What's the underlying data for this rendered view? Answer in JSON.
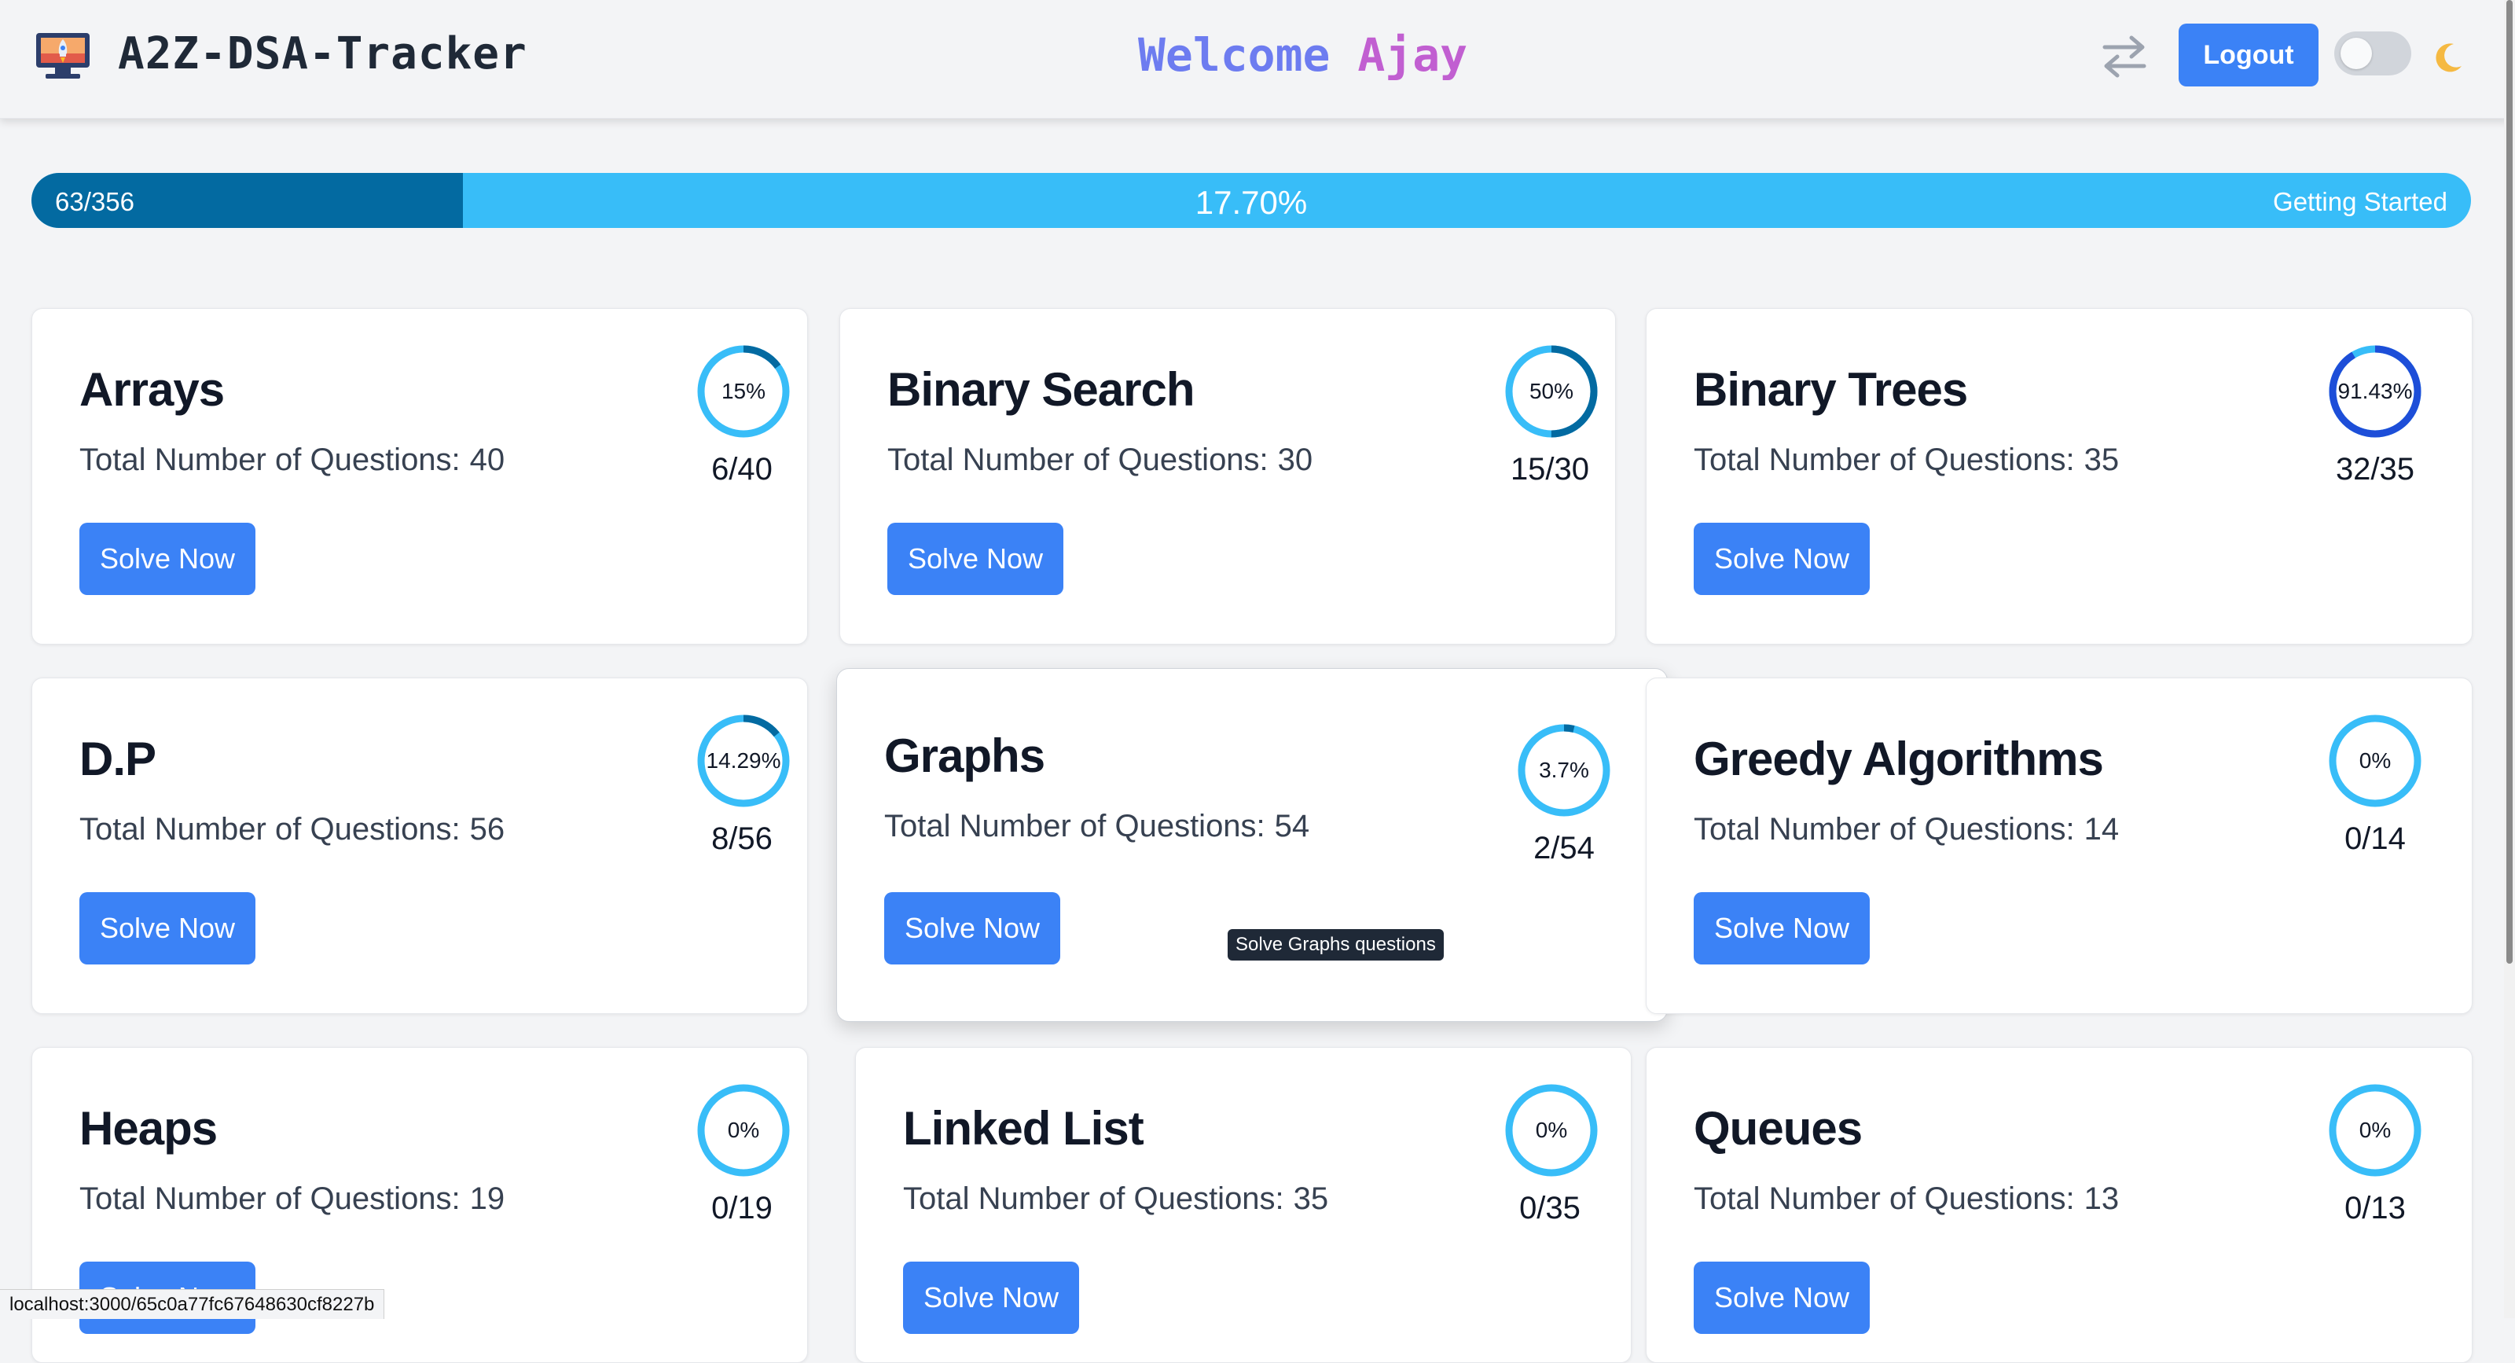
{
  "header": {
    "app_title": "A2Z-DSA-Tracker",
    "welcome_word": "Welcome",
    "user_name": "Ajay",
    "logout_label": "Logout",
    "icons": {
      "logo": "rocket-laptop-icon",
      "swap": "swap-arrows-icon",
      "theme": "moon-icon"
    },
    "dark_mode": false
  },
  "progress": {
    "count": "63/356",
    "percent": "17.70%",
    "fraction": 0.177,
    "status": "Getting Started"
  },
  "cards": [
    {
      "title": "Arrays",
      "subtitle": "Total Number of Questions:",
      "total": "40",
      "percent_label": "15%",
      "fraction": 0.15,
      "solved": "6/40",
      "button": "Solve Now",
      "ring_color": "#036aa1"
    },
    {
      "title": "Binary Search",
      "subtitle": "Total Number of Questions:",
      "total": "30",
      "percent_label": "50%",
      "fraction": 0.5,
      "solved": "15/30",
      "button": "Solve Now",
      "ring_color": "#036aa1"
    },
    {
      "title": "Binary Trees",
      "subtitle": "Total Number of Questions:",
      "total": "35",
      "percent_label": "91.43%",
      "fraction": 0.9143,
      "solved": "32/35",
      "button": "Solve Now",
      "ring_color": "#1d4ed8"
    },
    {
      "title": "D.P",
      "subtitle": "Total Number of Questions:",
      "total": "56",
      "percent_label": "14.29%",
      "fraction": 0.1429,
      "solved": "8/56",
      "button": "Solve Now",
      "ring_color": "#036aa1"
    },
    {
      "title": "Graphs",
      "subtitle": "Total Number of Questions:",
      "total": "54",
      "percent_label": "3.7%",
      "fraction": 0.037,
      "solved": "2/54",
      "button": "Solve Now",
      "ring_color": "#036aa1"
    },
    {
      "title": "Greedy Algorithms",
      "subtitle": "Total Number of Questions:",
      "total": "14",
      "percent_label": "0%",
      "fraction": 0,
      "solved": "0/14",
      "button": "Solve Now",
      "ring_color": "#036aa1"
    },
    {
      "title": "Heaps",
      "subtitle": "Total Number of Questions:",
      "total": "19",
      "percent_label": "0%",
      "fraction": 0,
      "solved": "0/19",
      "button": "Solve Now",
      "ring_color": "#036aa1"
    },
    {
      "title": "Linked List",
      "subtitle": "Total Number of Questions:",
      "total": "35",
      "percent_label": "0%",
      "fraction": 0,
      "solved": "0/35",
      "button": "Solve Now",
      "ring_color": "#036aa1"
    },
    {
      "title": "Queues",
      "subtitle": "Total Number of Questions:",
      "total": "13",
      "percent_label": "0%",
      "fraction": 0,
      "solved": "0/13",
      "button": "Solve Now",
      "ring_color": "#036aa1"
    }
  ],
  "tooltip": "Solve Graphs questions",
  "status_url": "localhost:3000/65c0a77fc67648630cf8227b",
  "colors": {
    "accent": "#3b82f6",
    "ring_track": "#38bdf8",
    "progress_fill": "#036aa1",
    "progress_track": "#38bdf8"
  }
}
